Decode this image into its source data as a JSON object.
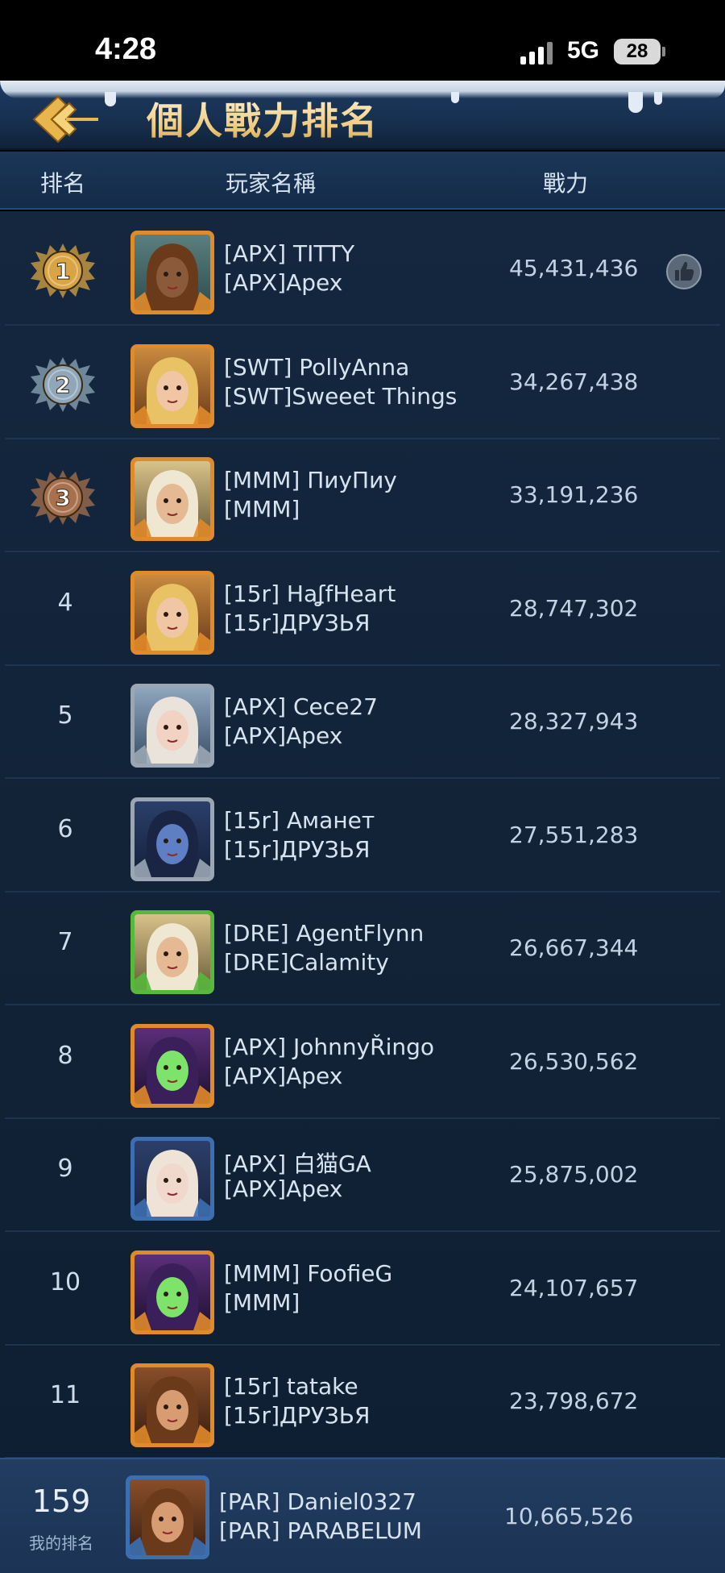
{
  "status_bar": {
    "time": "4:28",
    "network": "5G",
    "battery": "28"
  },
  "header": {
    "title": "個人戰力排名"
  },
  "columns": {
    "rank": "排名",
    "player": "玩家名稱",
    "power": "戰力"
  },
  "rows": [
    {
      "rank": "1",
      "name": "[APX] TITTY",
      "alliance": "[APX]Apex",
      "power": "45,431,436",
      "avatar": "wooden-mask-avatar"
    },
    {
      "rank": "2",
      "name": "[SWT] PollyAnna",
      "alliance": "[SWT]Sweeet Things",
      "power": "34,267,438",
      "avatar": "blonde-heroine-avatar"
    },
    {
      "rank": "3",
      "name": "[MMM] ПиуПиу",
      "alliance": "[MMM]",
      "power": "33,191,236",
      "avatar": "hooded-mage-avatar"
    },
    {
      "rank": "4",
      "name": "[15r] HaʆfHeart",
      "alliance": "[15r]ДРУЗЬЯ",
      "power": "28,747,302",
      "avatar": "blonde-heroine-avatar"
    },
    {
      "rank": "5",
      "name": "[APX] Cece27",
      "alliance": "[APX]Apex",
      "power": "28,327,943",
      "avatar": "silver-queen-avatar"
    },
    {
      "rank": "6",
      "name": "[15r] Аманет",
      "alliance": "[15r]ДРУЗЬЯ",
      "power": "27,551,283",
      "avatar": "blue-elf-avatar"
    },
    {
      "rank": "7",
      "name": "[DRE] AgentFlynn",
      "alliance": "[DRE]Calamity",
      "power": "26,667,344",
      "avatar": "hooded-mage-avatar"
    },
    {
      "rank": "8",
      "name": "[APX] JohnnyŘingo",
      "alliance": "[APX]Apex",
      "power": "26,530,562",
      "avatar": "green-skull-avatar"
    },
    {
      "rank": "9",
      "name": "[APX] 白猫GA",
      "alliance": "[APX]Apex",
      "power": "25,875,002",
      "avatar": "pirate-girl-avatar"
    },
    {
      "rank": "10",
      "name": "[MMM] FoofieG",
      "alliance": "[MMM]",
      "power": "24,107,657",
      "avatar": "green-skull-avatar"
    },
    {
      "rank": "11",
      "name": "[15r] tatake",
      "alliance": "[15r]ДРУЗЬЯ",
      "power": "23,798,672",
      "avatar": "bearded-king-avatar"
    }
  ],
  "my_rank": {
    "rank": "159",
    "label": "我的排名",
    "name": "[PAR] Daniel0327",
    "alliance": "[PAR] PARABELUM",
    "power": "10,665,526",
    "avatar": "bearded-king-avatar"
  },
  "colors": {
    "gold": "#d9a443",
    "silver": "#8fa7b8",
    "bronze": "#a8714e",
    "frame_orange": "#e08a2a",
    "frame_green": "#58b83c",
    "frame_blue": "#3d6fb0",
    "frame_silver": "#9aa6b4"
  }
}
